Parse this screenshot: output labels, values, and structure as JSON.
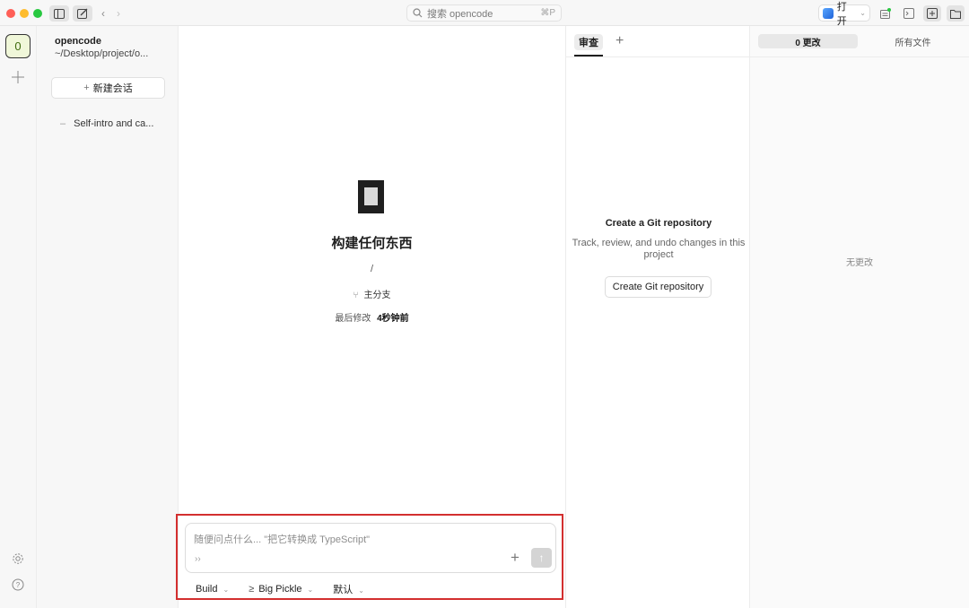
{
  "colors": {
    "traffic_red": "#ff5f57",
    "traffic_yellow": "#febc2e",
    "traffic_green": "#28c840",
    "highlight_border": "#d32f2f",
    "workspace_badge_bg": "#f0f7d9"
  },
  "titlebar": {
    "search_placeholder": "搜索 opencode",
    "search_shortcut": "⌘P",
    "open_label": "打开"
  },
  "rail": {
    "workspace_badge": "0"
  },
  "sidebar": {
    "project_name": "opencode",
    "project_path": "~/Desktop/project/o...",
    "new_session_label": "新建会话",
    "sessions": [
      {
        "dash": "–",
        "label": "Self-intro and ca..."
      }
    ]
  },
  "main": {
    "title": "构建任何东西",
    "path": "/",
    "branch_label": "主分支",
    "last_modified_label": "最后修改",
    "last_modified_value": "4秒钟前"
  },
  "composer": {
    "placeholder": "随便问点什么... \"把它转换成 TypeScript\"",
    "chevron": "››",
    "modes": [
      {
        "label": "Build"
      },
      {
        "label": "Big Pickle"
      },
      {
        "label": "默认"
      }
    ]
  },
  "review": {
    "tab_label": "审查",
    "git_title": "Create a Git repository",
    "git_description": "Track, review, and undo changes in this project",
    "git_button_label": "Create Git repository"
  },
  "changes": {
    "tab_changes_label": "0 更改",
    "tab_all_files_label": "所有文件",
    "empty_label": "无更改"
  }
}
